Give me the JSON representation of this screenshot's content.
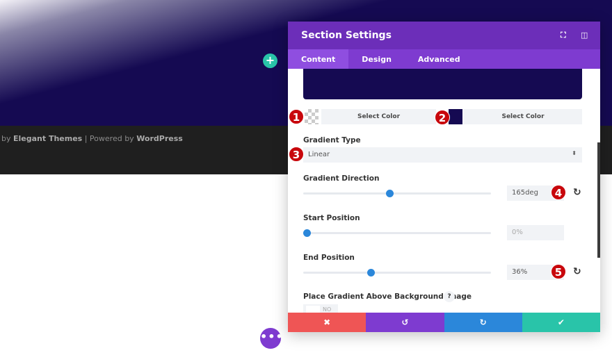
{
  "page": {
    "footer_prefix": "by ",
    "footer_brand": "Elegant Themes",
    "footer_mid": " | Powered by ",
    "footer_platform": "WordPress",
    "add_icon": "+",
    "more_icon": "•••"
  },
  "modal": {
    "title": "Section Settings",
    "tabs": [
      {
        "label": "Content",
        "active": true
      },
      {
        "label": "Design"
      },
      {
        "label": "Advanced"
      }
    ],
    "preview_color": "#150a52",
    "color1": {
      "label": "Select Color",
      "swatch": "transparent"
    },
    "color2": {
      "label": "Select Color",
      "swatch": "#150a52"
    },
    "gradient_type": {
      "label": "Gradient Type",
      "value": "Linear"
    },
    "gradient_direction": {
      "label": "Gradient Direction",
      "value": "165deg",
      "fraction": 0.458
    },
    "start_position": {
      "label": "Start Position",
      "value": "0%",
      "fraction": 0
    },
    "end_position": {
      "label": "End Position",
      "value": "36%",
      "fraction": 0.36
    },
    "place_above": {
      "label": "Place Gradient Above Background Image",
      "help": "?",
      "toggle": "NO"
    },
    "badges": [
      "1",
      "2",
      "3",
      "4",
      "5"
    ],
    "footer": {
      "cancel": "✖",
      "undo": "↺",
      "redo": "↻",
      "save": "✔"
    },
    "colors": {
      "header": "#6c2eb9",
      "tabs": "#7e3bd0",
      "cancel": "#ef5555",
      "undo": "#7e3bd0",
      "redo": "#2b87da",
      "save": "#29c4a9"
    }
  }
}
